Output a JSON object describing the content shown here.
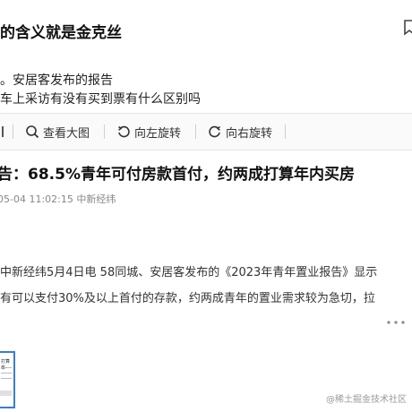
{
  "header": {
    "title_fragment": "的含义就是金克丝"
  },
  "snippets": [
    "。安居客发布的报告",
    "车上采访有没有买到票有什么区别吗"
  ],
  "toolbar": {
    "view_large": "查看大图",
    "rotate_left": "向左旋转",
    "rotate_right": "向右旋转"
  },
  "article": {
    "title": "告：68.5%青年可付房款首付，约两成打算年内买房",
    "meta": "05-04 11:02:15 中新经纬",
    "para1": "中新经纬5月4日电 58同城、安居客发布的《2023年青年置业报告》显示",
    "para2": "有可以支付30%及以上首付的存款，约两成青年的置业需求较为急切，拉"
  },
  "thumbnail": {
    "caption": "打算年"
  },
  "watermark": "@稀土掘金技术社区",
  "colors": {
    "accent": "#3a7bd5",
    "meta_gray": "#888888"
  },
  "icons": [
    "search-icon",
    "rotate-left-icon",
    "rotate-right-icon",
    "more-icon",
    "bookmark-icon"
  ]
}
